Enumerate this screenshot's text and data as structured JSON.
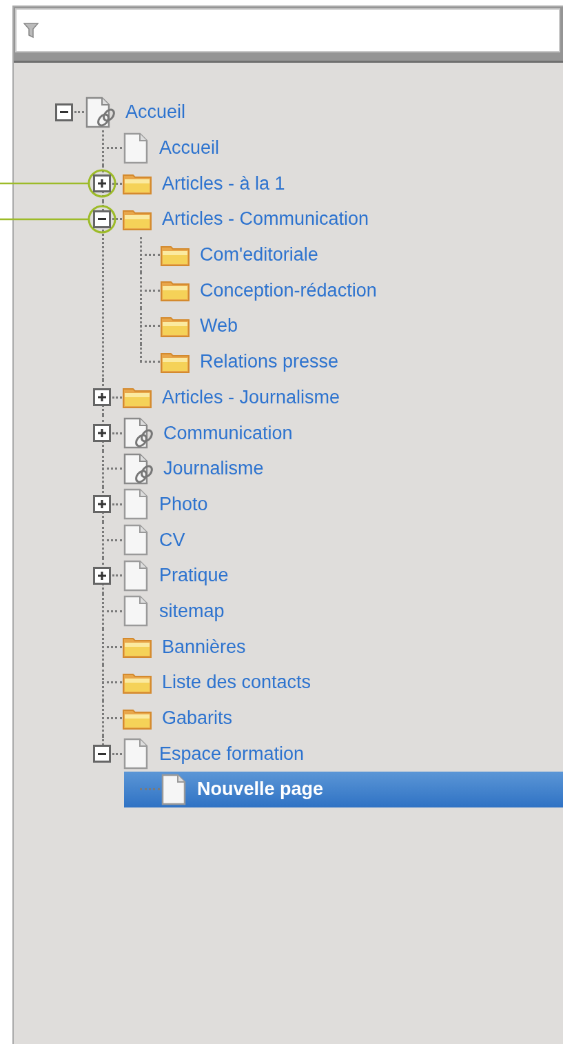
{
  "tree": [
    {
      "label": "Accueil",
      "kind": "linked-page",
      "expanded": true,
      "selected": false,
      "children": [
        {
          "label": "Accueil",
          "kind": "page",
          "selected": false
        },
        {
          "label": "Articles - à la 1",
          "kind": "folder",
          "expanded": false,
          "annotated": true,
          "selected": false
        },
        {
          "label": "Articles - Communication",
          "kind": "folder",
          "expanded": true,
          "annotated": true,
          "selected": false,
          "children": [
            {
              "label": "Com'editoriale",
              "kind": "folder",
              "selected": false
            },
            {
              "label": "Conception-rédaction",
              "kind": "folder",
              "selected": false
            },
            {
              "label": "Web",
              "kind": "folder",
              "selected": false
            },
            {
              "label": "Relations presse",
              "kind": "folder",
              "selected": false
            }
          ]
        },
        {
          "label": "Articles - Journalisme",
          "kind": "folder",
          "expanded": false,
          "selected": false
        },
        {
          "label": "Communication",
          "kind": "linked-page",
          "expanded": false,
          "selected": false
        },
        {
          "label": "Journalisme",
          "kind": "linked-page",
          "selected": false
        },
        {
          "label": "Photo",
          "kind": "page",
          "expanded": false,
          "selected": false
        },
        {
          "label": "CV",
          "kind": "page",
          "selected": false
        },
        {
          "label": "Pratique",
          "kind": "page",
          "expanded": false,
          "selected": false
        },
        {
          "label": "sitemap",
          "kind": "page",
          "selected": false
        },
        {
          "label": "Bannières",
          "kind": "folder",
          "selected": false
        },
        {
          "label": "Liste des contacts",
          "kind": "folder",
          "selected": false
        },
        {
          "label": "Gabarits",
          "kind": "folder",
          "selected": false
        },
        {
          "label": "Espace formation",
          "kind": "page",
          "expanded": true,
          "selected": false,
          "children": [
            {
              "label": "Nouvelle page",
              "kind": "page",
              "selected": true
            }
          ]
        }
      ]
    }
  ]
}
